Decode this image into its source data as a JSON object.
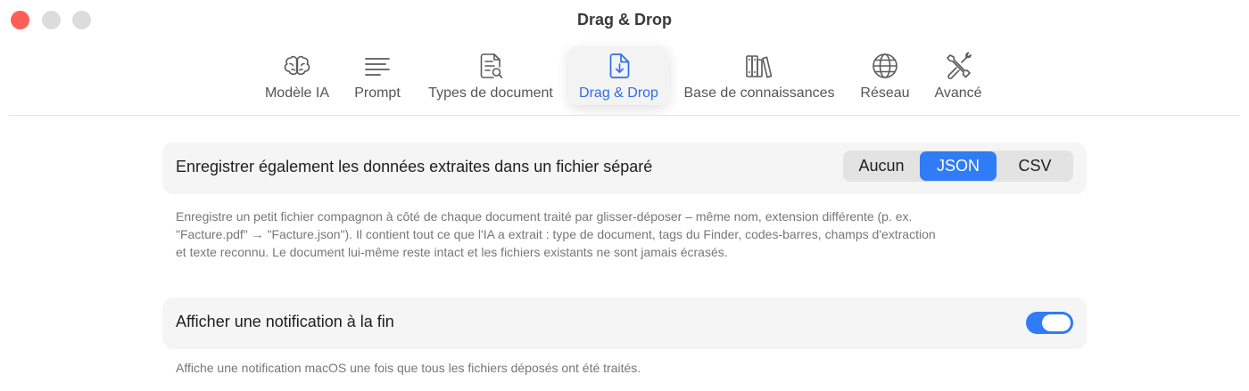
{
  "window": {
    "title": "Drag & Drop"
  },
  "tabs": [
    {
      "label": "Modèle IA",
      "icon": "brain-icon",
      "active": false
    },
    {
      "label": "Prompt",
      "icon": "text-lines-icon",
      "active": false
    },
    {
      "label": "Types de document",
      "icon": "document-search-icon",
      "active": false
    },
    {
      "label": "Drag & Drop",
      "icon": "document-download-icon",
      "active": true
    },
    {
      "label": "Base de connaissances",
      "icon": "books-icon",
      "active": false
    },
    {
      "label": "Réseau",
      "icon": "globe-icon",
      "active": false
    },
    {
      "label": "Avancé",
      "icon": "tools-icon",
      "active": false
    }
  ],
  "export_setting": {
    "label": "Enregistrer également les données extraites dans un fichier séparé",
    "options": [
      "Aucun",
      "JSON",
      "CSV"
    ],
    "selected": "JSON",
    "description_lines": [
      "Enregistre un petit fichier compagnon à côté de chaque document traité par glisser-déposer – même nom, extension différente (p. ex.",
      "\"Facture.pdf\" → \"Facture.json\"). Il contient tout ce que l'IA a extrait : type de document, tags du Finder, codes-barres, champs d'extraction",
      "et texte reconnu. Le document lui-même reste intact et les fichiers existants ne sont jamais écrasés."
    ]
  },
  "notification_setting": {
    "label": "Afficher une notification à la fin",
    "enabled": true,
    "description": "Affiche une notification macOS une fois que tous les fichiers déposés ont été traités."
  },
  "colors": {
    "accent": "#2f7cf6",
    "close": "#ff5f57"
  }
}
